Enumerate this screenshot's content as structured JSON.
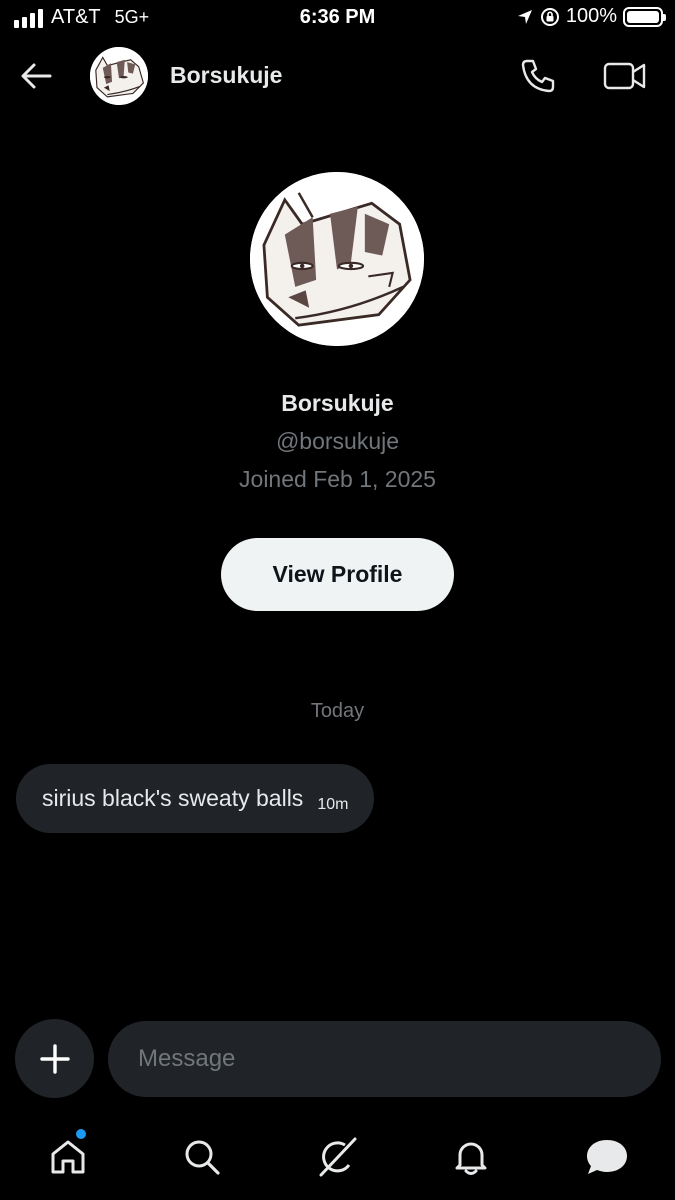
{
  "status_bar": {
    "carrier": "AT&T",
    "network": "5G+",
    "time": "6:36 PM",
    "battery": "100%",
    "battery_level": 1.0
  },
  "header": {
    "name": "Borsukuje",
    "icons": [
      "back-arrow-icon",
      "phone-icon",
      "video-icon"
    ]
  },
  "profile": {
    "name": "Borsukuje",
    "handle": "@borsukuje",
    "joined": "Joined Feb 1, 2025",
    "view_profile_label": "View Profile"
  },
  "conversation": {
    "day_label": "Today",
    "messages": [
      {
        "text": "sirius black's sweaty balls",
        "time": "10m"
      }
    ]
  },
  "composer": {
    "placeholder": "Message"
  },
  "tab_bar": {
    "items": [
      "home-icon",
      "search-icon",
      "grok-icon",
      "notifications-icon",
      "messages-icon"
    ],
    "home_badge_color": "#1d9bf0"
  },
  "colors": {
    "background": "#000000",
    "bubble": "#202327",
    "muted_text": "#71767b",
    "accent": "#1d9bf0"
  }
}
